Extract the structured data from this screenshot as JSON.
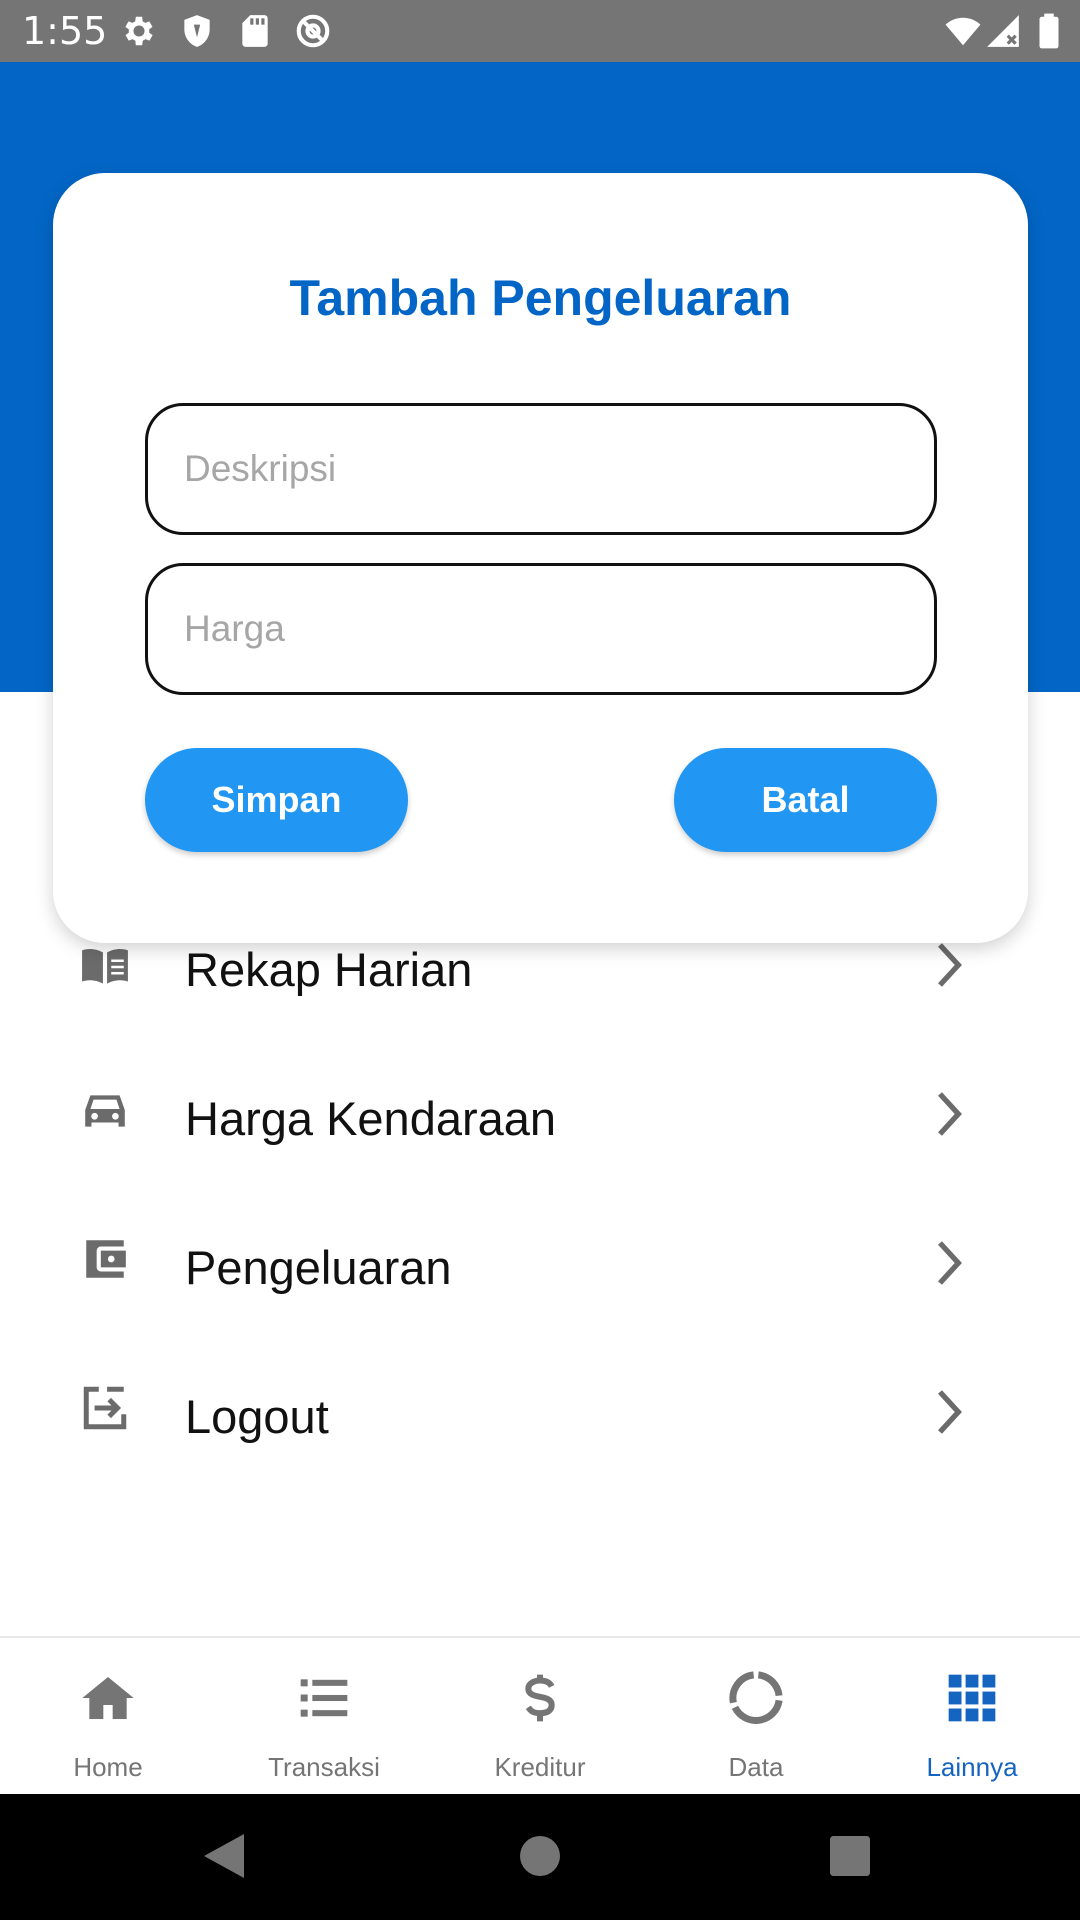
{
  "status_bar": {
    "time": "1:55",
    "left_icons": [
      "gear-icon",
      "shield-icon",
      "sd-card-icon",
      "at-sign-icon"
    ],
    "right_icons": [
      "wifi-icon",
      "signal-icon",
      "battery-icon"
    ]
  },
  "dialog": {
    "title": "Tambah Pengeluaran",
    "description_placeholder": "Deskripsi",
    "description_value": "",
    "price_placeholder": "Harga",
    "price_value": "",
    "save_label": "Simpan",
    "cancel_label": "Batal"
  },
  "menu": {
    "items": [
      {
        "label": "Rekap Harian",
        "icon": "book-icon"
      },
      {
        "label": "Harga Kendaraan",
        "icon": "car-icon"
      },
      {
        "label": "Pengeluaran",
        "icon": "wallet-icon"
      },
      {
        "label": "Logout",
        "icon": "logout-icon"
      }
    ]
  },
  "bottom_nav": {
    "items": [
      {
        "label": "Home",
        "icon": "home-icon"
      },
      {
        "label": "Transaksi",
        "icon": "list-icon"
      },
      {
        "label": "Kreditur",
        "icon": "dollar-icon"
      },
      {
        "label": "Data",
        "icon": "donut-chart-icon"
      },
      {
        "label": "Lainnya",
        "icon": "apps-grid-icon"
      }
    ],
    "active": "Lainnya"
  },
  "colors": {
    "primary": "#0366C6",
    "button": "#2196F3",
    "active_nav": "#1565C0",
    "inactive_nav": "#757575",
    "status_bar": "#757575"
  }
}
